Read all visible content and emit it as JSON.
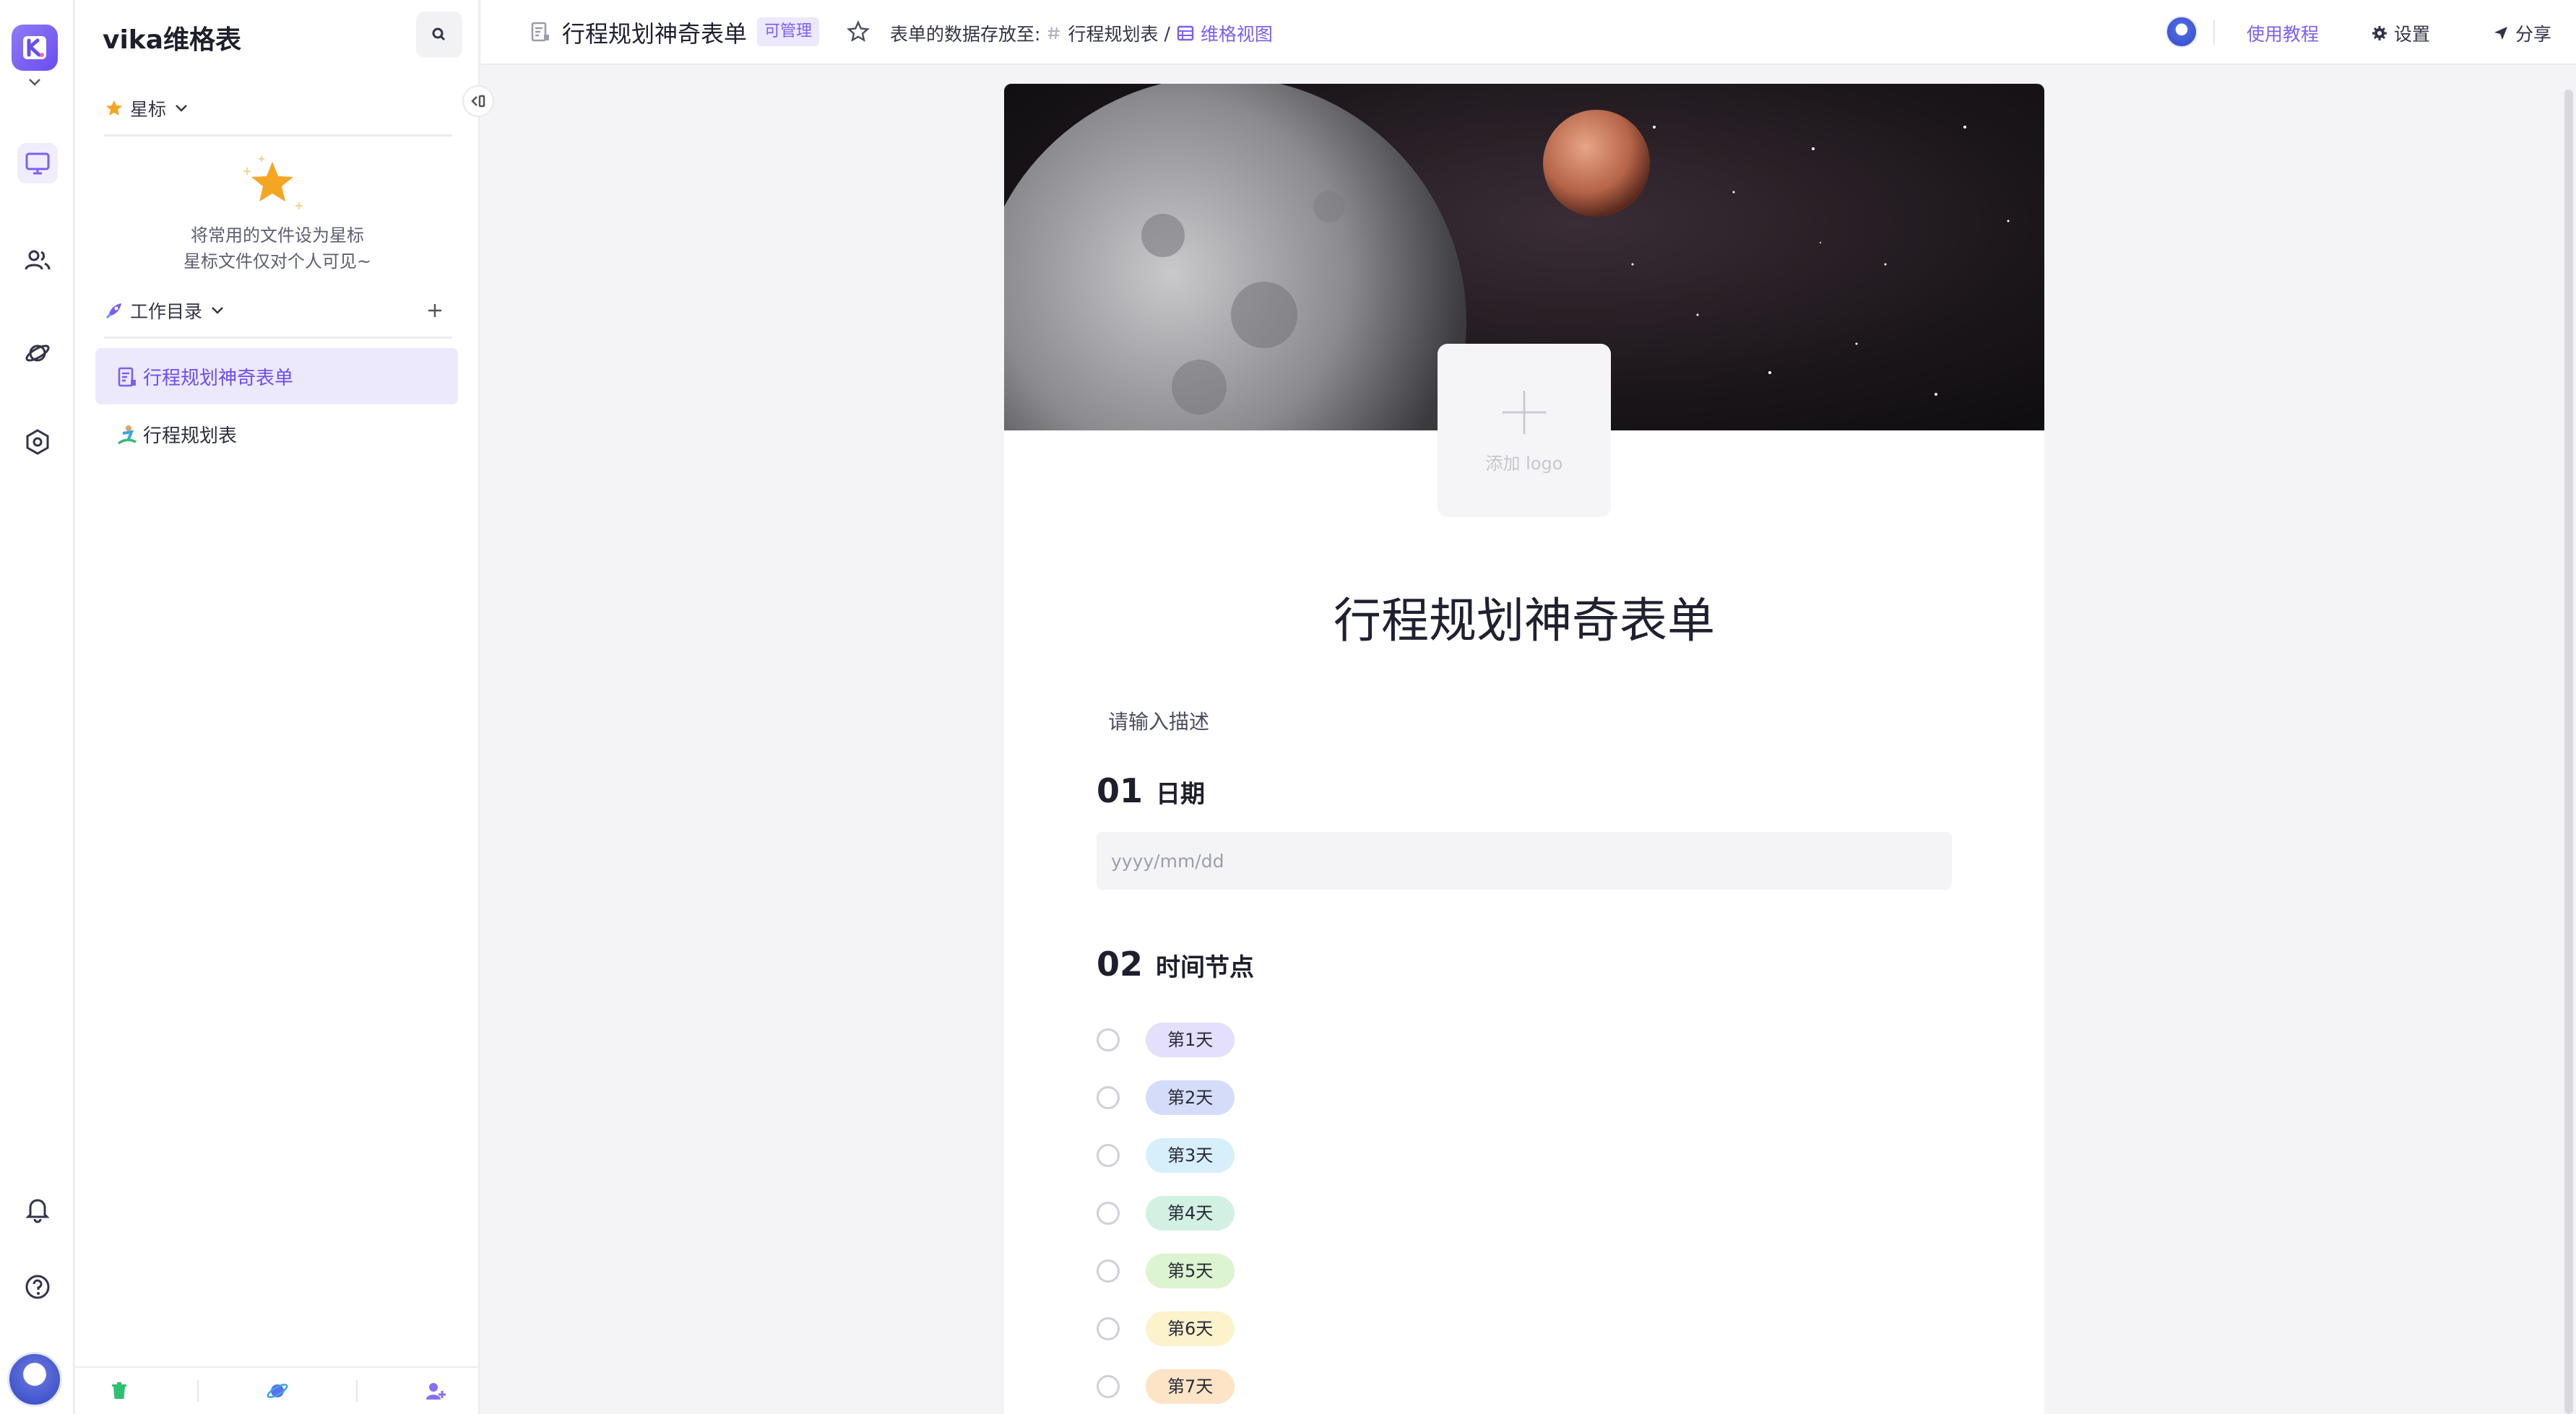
{
  "workspace": {
    "name": "vika维格表"
  },
  "sidebar": {
    "starred_label": "星标",
    "starred_empty_line1": "将常用的文件设为星标",
    "starred_empty_line2": "星标文件仅对个人可见~",
    "catalog_label": "工作目录",
    "items": [
      {
        "label": "行程规划神奇表单",
        "type": "form",
        "active": true
      },
      {
        "label": "行程规划表",
        "type": "datasheet",
        "active": false
      }
    ]
  },
  "topbar": {
    "title": "行程规划神奇表单",
    "permission_badge": "可管理",
    "storage_label": "表单的数据存放至:",
    "storage_sheet": "行程规划表",
    "storage_sep": "/",
    "storage_view": "维格视图",
    "tutorial": "使用教程",
    "settings": "设置",
    "share": "分享"
  },
  "form": {
    "logo_placeholder": "添加 logo",
    "title": "行程规划神奇表单",
    "description_placeholder": "请输入描述",
    "questions": [
      {
        "num": "01",
        "label": "日期",
        "placeholder": "yyyy/mm/dd"
      },
      {
        "num": "02",
        "label": "时间节点"
      }
    ],
    "options": [
      {
        "label": "第1天",
        "color": "#e4dffb"
      },
      {
        "label": "第2天",
        "color": "#d4dcfa"
      },
      {
        "label": "第3天",
        "color": "#d6effb"
      },
      {
        "label": "第4天",
        "color": "#d2f1e3"
      },
      {
        "label": "第5天",
        "color": "#dcf4d0"
      },
      {
        "label": "第6天",
        "color": "#fcf2cc"
      },
      {
        "label": "第7天",
        "color": "#fde4c6"
      }
    ]
  },
  "colors": {
    "accent": "#7b5ff4",
    "active_bg": "#ede9fd"
  }
}
